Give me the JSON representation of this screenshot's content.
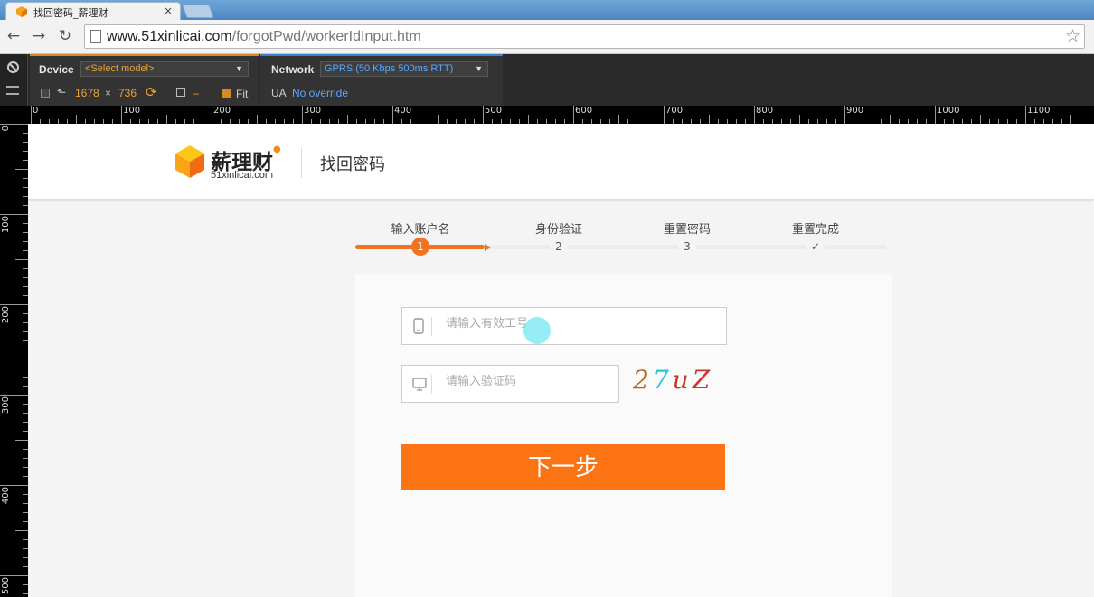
{
  "browser": {
    "tab_title": "找回密码_薪理财",
    "tab_close": "×",
    "url_host": "www.51xinlicai.com",
    "url_path": "/forgotPwd/workerIdInput.htm"
  },
  "devtools": {
    "device_label": "Device",
    "device_model": "<Select model>",
    "width": "1678",
    "times": "×",
    "height": "736",
    "scale_dash": "–",
    "fit_label": "Fit",
    "network_label": "Network",
    "network_value": "GPRS (50 Kbps 500ms RTT)",
    "ua_label": "UA",
    "ua_value": "No override"
  },
  "ruler": {
    "h_labels": [
      "0",
      "100",
      "200",
      "300",
      "400",
      "500",
      "600",
      "700",
      "800",
      "900",
      "1000",
      "1100"
    ],
    "v_labels": [
      "0",
      "100",
      "200",
      "300",
      "400",
      "500"
    ]
  },
  "site": {
    "logo_text": "薪理财",
    "logo_sub": "51xinlicai.com",
    "header_title": "找回密码"
  },
  "steps": [
    {
      "label": "输入账户名",
      "num": "1",
      "active": true
    },
    {
      "label": "身份验证",
      "num": "2",
      "active": false
    },
    {
      "label": "重置密码",
      "num": "3",
      "active": false
    },
    {
      "label": "重置完成",
      "num": "✓",
      "active": false
    }
  ],
  "form": {
    "worker_id_placeholder": "请输入有效工号",
    "captcha_placeholder": "请输入验证码",
    "captcha_chars": [
      "2",
      "7",
      "u",
      "Z"
    ],
    "next_label": "下一步"
  },
  "colors": {
    "accent": "#f07322",
    "button": "#fb7312"
  }
}
